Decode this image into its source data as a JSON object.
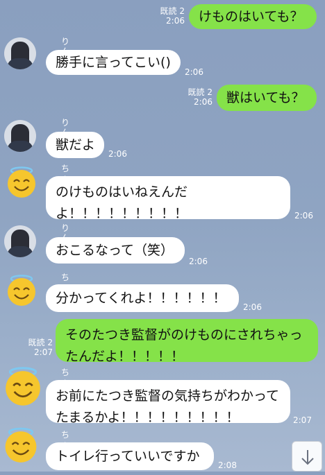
{
  "messages": [
    {
      "side": "out",
      "text": "けものはいても？",
      "read": "既読 2",
      "time": "2:06"
    },
    {
      "side": "in",
      "sender": "りんな",
      "text": "勝手に言ってこい()",
      "time": "2:06"
    },
    {
      "side": "out",
      "text": "獣はいても？",
      "read": "既読 2",
      "time": "2:06"
    },
    {
      "side": "in",
      "sender": "りんな",
      "text": "獣だよ",
      "time": "2:06"
    },
    {
      "side": "in",
      "sender": "ちゃっち",
      "text": "のけものはいねえんだよ！！！！！！！！！",
      "time": "2:06"
    },
    {
      "side": "in",
      "sender": "りんな",
      "text": "おこるなって（笑）",
      "time": "2:06"
    },
    {
      "side": "in",
      "sender": "ちゃっち",
      "text": "分かってくれよ！！！！！！",
      "time": "2:06"
    },
    {
      "side": "out",
      "text": "そのたつき監督がのけものにされちゃったんだよ！！！！！",
      "read": "既読 2",
      "time": "2:07"
    },
    {
      "side": "in",
      "sender": "ちゃっち",
      "text": "お前にたつき監督の気持ちがわかってたまるかよ！！！！！！！！！",
      "time": "2:07"
    },
    {
      "side": "in",
      "sender": "ちゃっち",
      "text": "トイレ行っていいですか",
      "time": "2:08"
    }
  ],
  "scroll_button": {
    "icon": "arrow-down-icon"
  },
  "colors": {
    "outgoing": "#85e249",
    "incoming": "#ffffff",
    "background": "#8fa4c2"
  }
}
